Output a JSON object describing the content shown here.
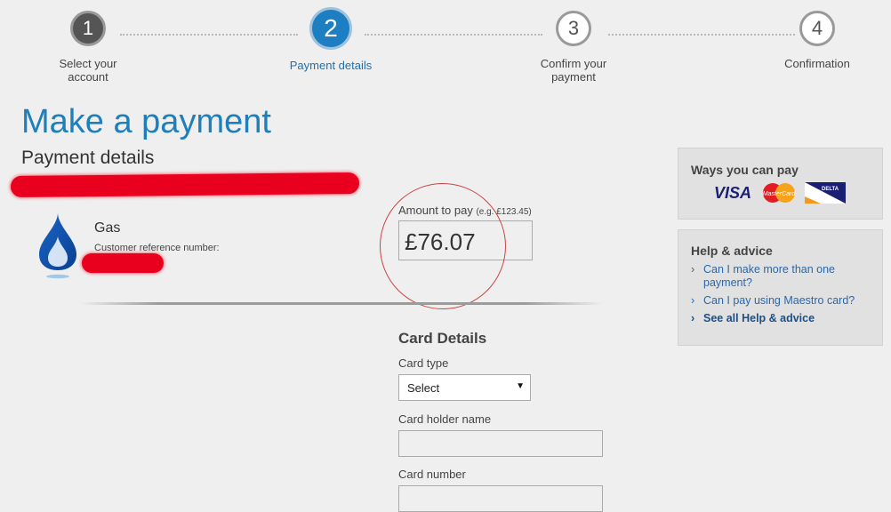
{
  "stepper": {
    "steps": [
      {
        "number": "1",
        "label": "Select your account",
        "state": "completed"
      },
      {
        "number": "2",
        "label": "Payment details",
        "state": "active"
      },
      {
        "number": "3",
        "label": "Confirm your payment",
        "state": "pending"
      },
      {
        "number": "4",
        "label": "Confirmation",
        "state": "pending"
      }
    ]
  },
  "page": {
    "title": "Make a payment",
    "section": "Payment details"
  },
  "account": {
    "icon": "gas-flame-icon",
    "name": "Gas",
    "reference_label": "Customer reference number:"
  },
  "amount": {
    "label": "Amount to pay",
    "example": "(e.g. £123.45)",
    "currency_symbol": "£",
    "value": "76.07"
  },
  "card_details": {
    "title": "Card Details",
    "card_type_label": "Card type",
    "card_type_value": "Select",
    "holder_label": "Card holder name",
    "holder_value": "",
    "number_label": "Card number",
    "number_value": ""
  },
  "sidebar": {
    "pay_title": "Ways you can pay",
    "card_logos": [
      "VISA",
      "MasterCard",
      "DELTA"
    ],
    "help_title": "Help & advice",
    "help_links": [
      {
        "text": "Can I make more than one payment?"
      },
      {
        "text": "Can I pay using Maestro card?"
      },
      {
        "text": "See all Help & advice"
      }
    ]
  },
  "colors": {
    "brand_blue": "#1e7fbb",
    "active_step": "#1d7fc2",
    "link": "#2a68a8",
    "redaction": "#e8001e"
  }
}
